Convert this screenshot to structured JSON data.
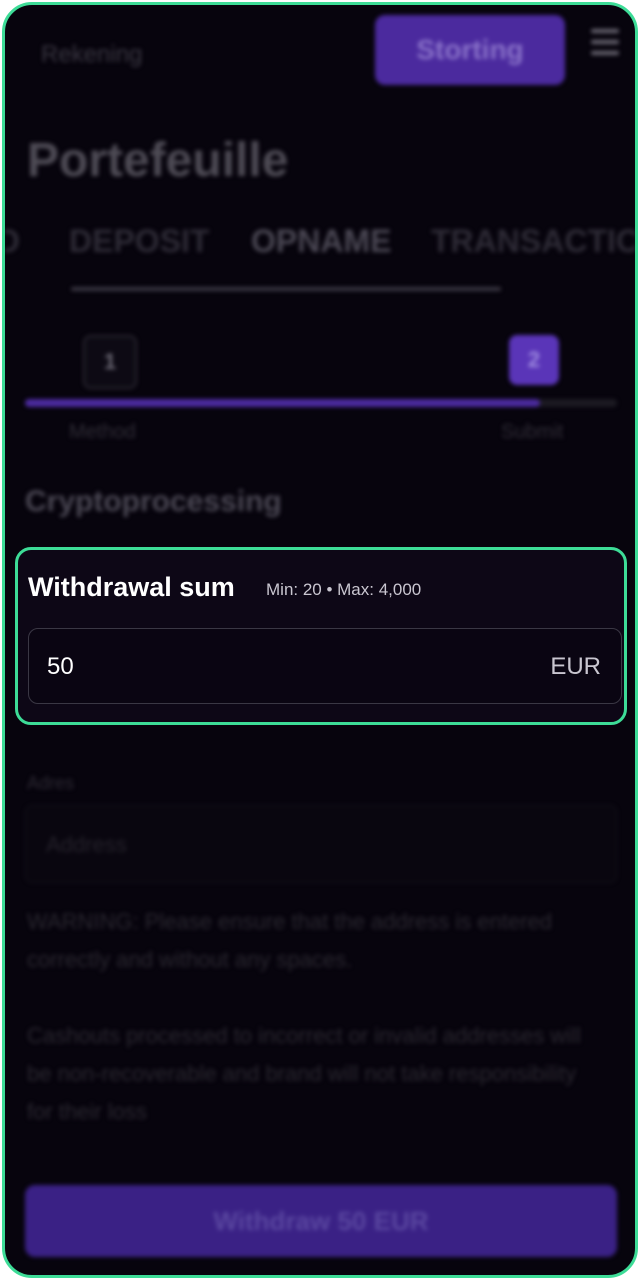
{
  "header": {
    "account_link": "Rekening",
    "deposit_button": "Storting"
  },
  "page": {
    "title": "Portefeuille"
  },
  "tabs": [
    {
      "label": "O"
    },
    {
      "label": "DEPOSIT"
    },
    {
      "label": "OPNAME",
      "active": true
    },
    {
      "label": "TRANSACTIONS"
    }
  ],
  "stepper": {
    "progress_fraction": 0.87,
    "steps": [
      {
        "number": "1",
        "label": "Method"
      },
      {
        "number": "2",
        "label": "Submit",
        "active": true
      }
    ]
  },
  "method": {
    "title": "Cryptoprocessing"
  },
  "withdrawal": {
    "title": "Withdrawal sum",
    "limits": "Min: 20 • Max: 4,000",
    "value": "50",
    "currency": "EUR"
  },
  "address": {
    "label": "Adres",
    "placeholder": "Address"
  },
  "warning_text": "WARNING: Please ensure that the address is entered correctly and without any spaces.",
  "notice_text": "Cashouts processed to incorrect or invalid addresses will be non-recoverable and brand will not take responsibility for their loss",
  "submit": {
    "label": "Withdraw 50 EUR"
  },
  "colors": {
    "accent": "#5a35b8",
    "highlight": "#3ddc97",
    "background": "#07040d"
  }
}
